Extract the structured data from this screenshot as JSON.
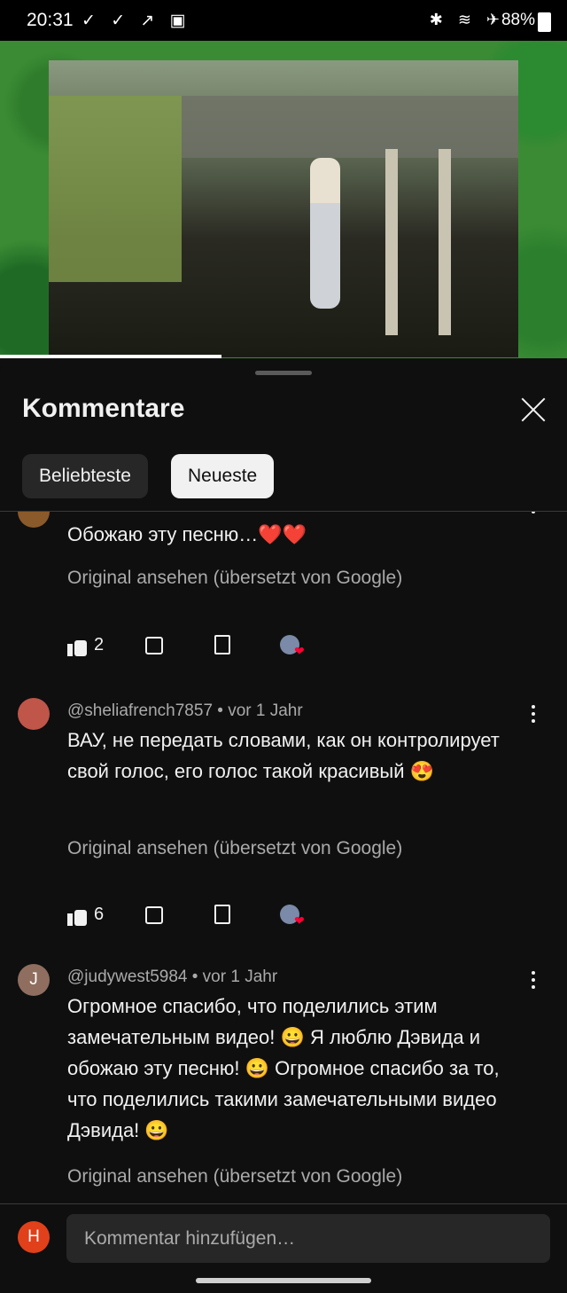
{
  "status_bar": {
    "time": "20:31",
    "left_icons": [
      "check-icon",
      "check-icon",
      "navigation-icon",
      "battery-saver-icon"
    ],
    "right_icons": [
      "bluetooth-icon",
      "wifi-icon",
      "airplane-icon"
    ],
    "battery": "88%"
  },
  "video": {
    "progress_fraction": 0.39
  },
  "sheet": {
    "title": "Kommentare",
    "chips": [
      "Beliebteste",
      "Neueste"
    ],
    "selected_chip": "Neueste"
  },
  "comments": [
    {
      "handle": "",
      "age": "",
      "text": "Обожаю эту песню…❤️❤️",
      "original_link": "Original ansehen (übersetzt von Google)",
      "likes": "2"
    },
    {
      "handle": "@sheliafrench7857",
      "age": "vor 1 Jahr",
      "meta": "@sheliafrench7857 • vor 1 Jahr",
      "text": "ВАУ, не передать словами, как он контролирует свой голос, его голос такой красивый 😍",
      "original_link": "Original ansehen (übersetzt von Google)",
      "likes": "6"
    },
    {
      "handle": "@judywest5984",
      "age": "vor 1 Jahr",
      "meta": "@judywest5984 • vor 1 Jahr",
      "avatar_letter": "J",
      "text": "Огромное спасибо, что поделились этим замечательным видео! 😀 Я люблю Дэвида и обожаю эту песню! 😀 Огромное спасибо за то, что поделились такими замечательными видео Дэвида! 😀",
      "original_link": "Original ansehen (übersetzt von Google)"
    }
  ],
  "composer": {
    "avatar_letter": "H",
    "placeholder": "Kommentar hinzufügen…"
  },
  "colors": {
    "background": "#0f0f0f",
    "chip_selected": "#f1f1f1",
    "heart": "#ff0033",
    "composer_avatar": "#e0401a"
  }
}
